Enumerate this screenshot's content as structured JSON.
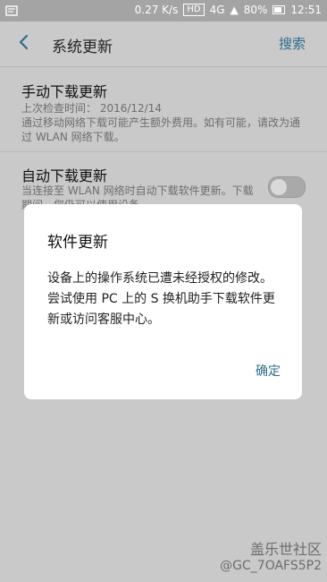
{
  "status_bar": {
    "speed": "0.27 K/s",
    "hd_label": "HD",
    "network": "4G",
    "battery": "80%",
    "time": "12:51"
  },
  "header": {
    "title": "系统更新",
    "search_label": "搜索"
  },
  "settings": [
    {
      "title": "手动下载更新",
      "sub": "上次检查时间： 2016/12/14\n通过移动网络下载可能产生额外费用。如有可能，请改为通过 WLAN 网络下载。"
    },
    {
      "title": "自动下载更新",
      "sub": "当连接至 WLAN 网络时自动下载软件更新。下载期间，您仍可以使用设备。",
      "toggle_state": "off"
    }
  ],
  "dialog": {
    "title": "软件更新",
    "body": "设备上的操作系统已遭未经授权的修改。尝试使用 PC 上的 S 换机助手下载软件更新或访问客服中心。",
    "ok_label": "确定"
  },
  "watermark": {
    "line1": "盖乐世社区",
    "line2": "@GC_7OAFS5P2"
  },
  "colors": {
    "accent": "#2c6d8e",
    "background": "#c9c9c9",
    "dialog": "#ffffff"
  }
}
